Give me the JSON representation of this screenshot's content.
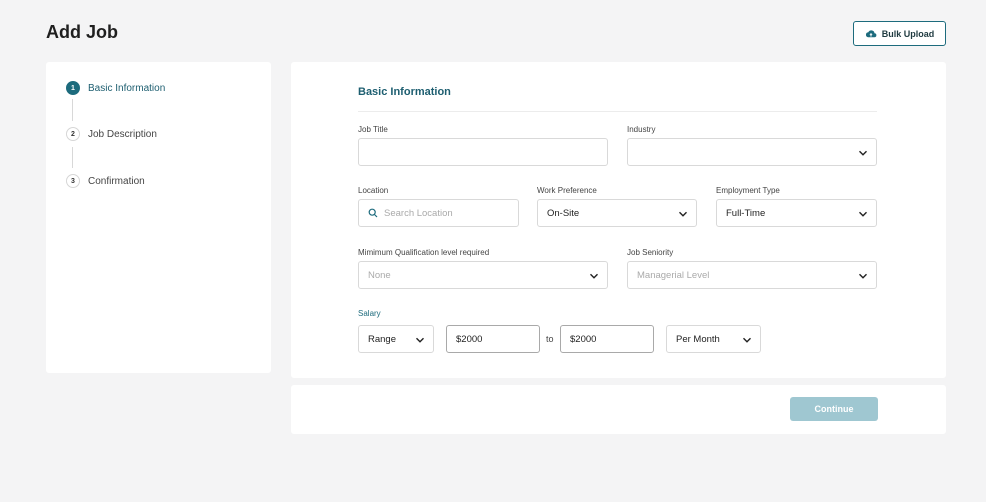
{
  "header": {
    "title": "Add Job",
    "bulk_upload_label": "Bulk Upload",
    "bulk_upload_icon": "cloud-upload-icon"
  },
  "steps": [
    {
      "number": "1",
      "label": "Basic Information",
      "active": true
    },
    {
      "number": "2",
      "label": "Job Description",
      "active": false
    },
    {
      "number": "3",
      "label": "Confirmation",
      "active": false
    }
  ],
  "form": {
    "section_title": "Basic Information",
    "job_title": {
      "label": "Job Title",
      "value": ""
    },
    "industry": {
      "label": "Industry",
      "value": ""
    },
    "location": {
      "label": "Location",
      "placeholder": "Search Location"
    },
    "work_preference": {
      "label": "Work Preference",
      "value": "On-Site"
    },
    "employment_type": {
      "label": "Employment Type",
      "value": "Full-Time"
    },
    "min_qualification": {
      "label": "Mimimum Qualification level required",
      "placeholder": "None"
    },
    "job_seniority": {
      "label": "Job Seniority",
      "placeholder": "Managerial Level"
    },
    "salary": {
      "label": "Salary",
      "type": "Range",
      "min": "$2000",
      "separator": "to",
      "max": "$2000",
      "period": "Per Month"
    }
  },
  "actions": {
    "continue_label": "Continue"
  },
  "colors": {
    "accent": "#1d6b7d",
    "continue_disabled": "#9fc7d1",
    "background": "#f4f4f5"
  }
}
